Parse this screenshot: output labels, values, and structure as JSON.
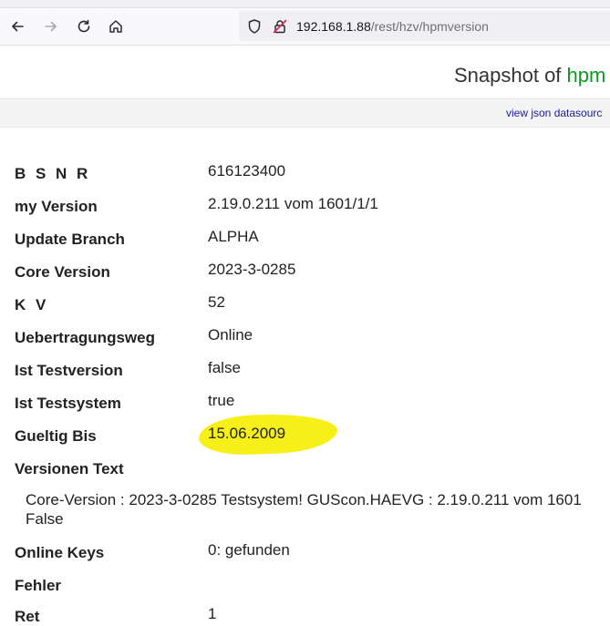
{
  "browser": {
    "url_host": "192.168.1.88",
    "url_path": "/rest/hzv/hpmversion"
  },
  "header": {
    "title_prefix": "Snapshot of ",
    "title_accent": "hpm"
  },
  "subbar": {
    "json_link": "view json datasourc"
  },
  "fields": [
    {
      "label": "B S N R",
      "value": "616123400"
    },
    {
      "label": "my Version",
      "value": "2.19.0.211 vom 1601/1/1"
    },
    {
      "label": "Update Branch",
      "value": "ALPHA"
    },
    {
      "label": "Core Version",
      "value": "2023-3-0285"
    },
    {
      "label": "K V",
      "value": "52"
    },
    {
      "label": "Uebertragungsweg",
      "value": "Online"
    },
    {
      "label": "Ist Testversion",
      "value": "false"
    },
    {
      "label": "Ist Testsystem",
      "value": "true"
    },
    {
      "label": "Gueltig Bis",
      "value": "15.06.2009"
    },
    {
      "label": "Versionen Text",
      "value": ""
    },
    {
      "label": "Online Keys",
      "value": "0: gefunden"
    },
    {
      "label": "Fehler",
      "value": ""
    },
    {
      "label": "Ret",
      "value": "1"
    }
  ],
  "versionen_text": {
    "line1": "Core-Version : 2023-3-0285 Testsystem! GUScon.HAEVG : 2.19.0.211 vom 1601",
    "line2": "False"
  },
  "colors": {
    "accent_green": "#0a9a1e",
    "highlight_yellow": "#f6ef18",
    "link_blue": "#1a1aa6"
  }
}
